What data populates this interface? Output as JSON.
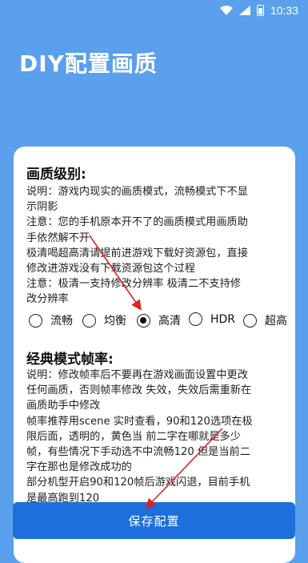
{
  "status_bar": {
    "time": "10:33"
  },
  "page_title": "DIY配置画质",
  "quality_section": {
    "title": "画质级别:",
    "lines": [
      "说明：游戏内现实的画质模式，流畅模式下不显",
      "示阴影",
      "注意：您的手机原本开不了的画质模式用画质助",
      "手依然解不开",
      "极清喝超高清请提前进游戏下载好资源包，直接",
      "修改进游戏没有下载资源包这个过程",
      "注意：极清一支持修改分辨率 极清二不支持修",
      "改分辨率"
    ],
    "options": [
      "流畅",
      "均衡",
      "高清",
      "HDR",
      "超高"
    ],
    "selected": "高清"
  },
  "framerate_section": {
    "title": "经典模式帧率:",
    "lines": [
      "说明：修改帧率后不要再在游戏画面设置中更改",
      "任何画质，否则帧率修改 失效，失效后需重新在",
      "画质助手中修改",
      "帧率推荐用scene 实时查看，90和120选项在极",
      "限后面，透明的，黄色当 前二字在哪就是多少",
      "帧，有些情况下手动选不中流畅120 但是当前二",
      "字在那也是修改成功的",
      "部分机型开启90和120帧后游戏闪退，目前手机",
      "是最高跑到120"
    ]
  },
  "save_button": "保存配置",
  "colors": {
    "background": "#5aa0ec",
    "button": "#1e6fdc",
    "annotation_arrow": "#e02020"
  }
}
